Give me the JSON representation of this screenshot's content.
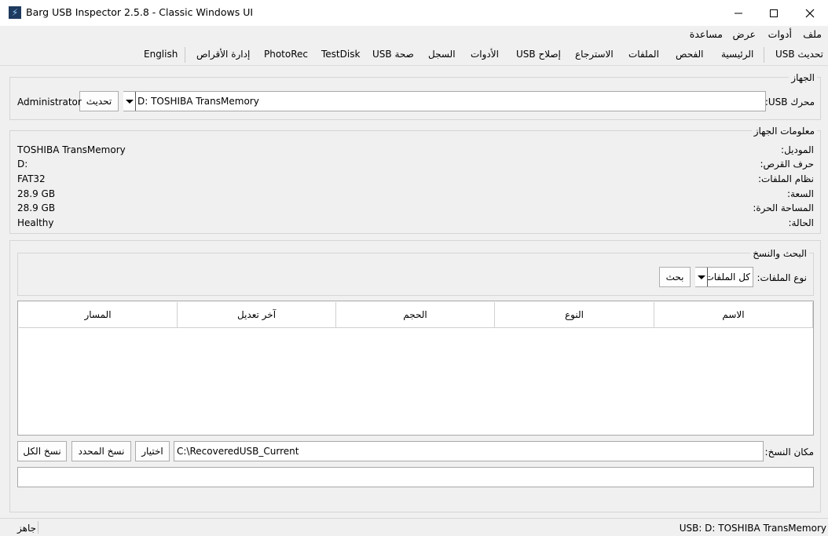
{
  "window": {
    "title": "Barg USB Inspector 2.5.8 - Classic Windows UI",
    "icon": "bolt-icon"
  },
  "menu": [
    "ملف",
    "أدوات",
    "عرض",
    "مساعدة"
  ],
  "toolbar": {
    "items": [
      "USB تحديث",
      "الرئيسية",
      "الفحص",
      "الملفات",
      "الاسترجاع",
      "USB إصلاح",
      "الأدوات",
      "السجل",
      "USB صحة",
      "TestDisk",
      "PhotoRec",
      "إدارة الأقراص"
    ],
    "language": "English"
  },
  "device": {
    "group_label": "الجهاز",
    "drive_label": "محرك USB:",
    "drive_value": "D:  TOSHIBA TransMemory",
    "refresh_button": "تحديث",
    "user": "Administrator"
  },
  "info": {
    "group_label": "معلومات الجهاز",
    "rows": [
      {
        "label": "الموديل:",
        "value": "TOSHIBA TransMemory"
      },
      {
        "label": "حرف القرص:",
        "value": "D:"
      },
      {
        "label": "نظام الملفات:",
        "value": "FAT32"
      },
      {
        "label": "السعة:",
        "value": "28.9 GB"
      },
      {
        "label": "المساحة الحرة:",
        "value": "28.9 GB"
      },
      {
        "label": "الحالة:",
        "value": "Healthy"
      }
    ]
  },
  "search": {
    "group_label": "البحث والنسخ",
    "file_type_label": "نوع الملفات:",
    "file_type_value": "كل الملفات",
    "search_button": "بحث"
  },
  "table": {
    "columns": [
      "الاسم",
      "النوع",
      "الحجم",
      "آخر تعديل",
      "المسار"
    ],
    "rows": []
  },
  "copy": {
    "location_label": "مكان النسخ:",
    "location_value": "C:\\RecoveredUSB_Current",
    "choose_button": "اختيار",
    "copy_selected_button": "نسخ المحدد",
    "copy_all_button": "نسخ الكل"
  },
  "status": {
    "left": "جاهز",
    "right": "USB: D: TOSHIBA TransMemory"
  }
}
